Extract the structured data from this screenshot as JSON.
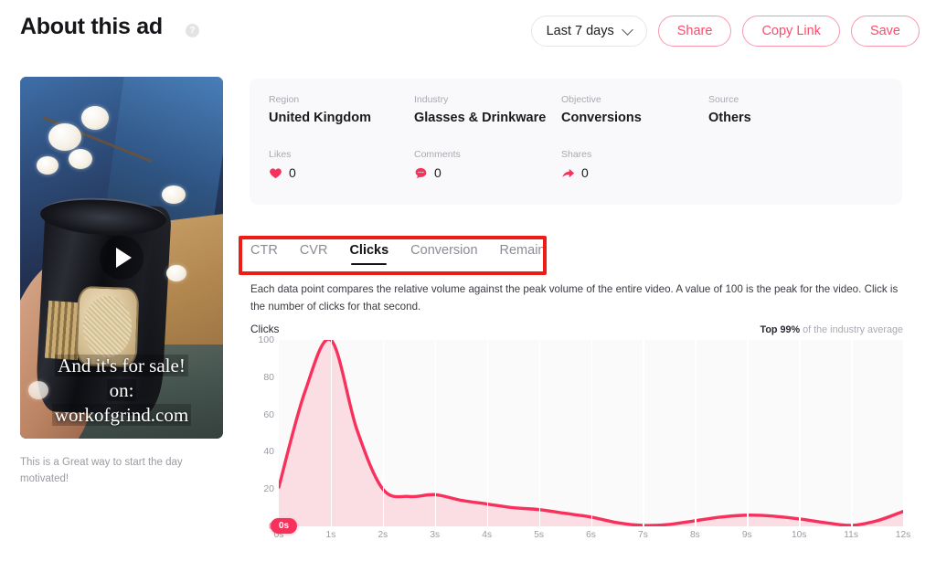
{
  "header": {
    "title": "About this ad",
    "help_icon": "question-mark-icon",
    "date_filter": "Last 7 days",
    "share_label": "Share",
    "copy_link_label": "Copy Link",
    "save_label": "Save"
  },
  "video": {
    "caption_line1": "And it's for sale!",
    "caption_line2": "on:",
    "caption_line3": "workofgrind.com",
    "description": "This is a Great way to start the day motivated!",
    "play_icon": "play-icon"
  },
  "info": {
    "region_label": "Region",
    "region_value": "United Kingdom",
    "industry_label": "Industry",
    "industry_value": "Glasses & Drinkware",
    "objective_label": "Objective",
    "objective_value": "Conversions",
    "source_label": "Source",
    "source_value": "Others",
    "likes_label": "Likes",
    "likes_value": "0",
    "comments_label": "Comments",
    "comments_value": "0",
    "shares_label": "Shares",
    "shares_value": "0"
  },
  "tabs": [
    {
      "label": "CTR",
      "active": false
    },
    {
      "label": "CVR",
      "active": false
    },
    {
      "label": "Clicks",
      "active": true
    },
    {
      "label": "Conversion",
      "active": false
    },
    {
      "label": "Remain",
      "active": false
    }
  ],
  "chart_description": "Each data point compares the relative volume against the peak volume of the entire video. A value of 100 is the peak for the video. Click is the number of clicks for that second.",
  "chart_header": {
    "title": "Clicks",
    "benchmark_prefix": "Top",
    "benchmark_value": "99%",
    "benchmark_suffix": "of the industry average"
  },
  "colors": {
    "accent_pink": "#f8305c",
    "accent_pink_light": "#fce0e7",
    "annotation_red": "#ee1c17",
    "panel_bg": "#f9f9fb",
    "plot_bg": "#fafafa"
  },
  "chart_data": {
    "type": "area",
    "title": "Clicks",
    "xlabel": "",
    "ylabel": "Clicks",
    "xlim": [
      0,
      12
    ],
    "ylim": [
      0,
      100
    ],
    "yticks": [
      0,
      20,
      40,
      60,
      80,
      100
    ],
    "xticks": [
      "0s",
      "1s",
      "2s",
      "3s",
      "4s",
      "5s",
      "6s",
      "7s",
      "8s",
      "9s",
      "10s",
      "11s",
      "12s"
    ],
    "grid": "vertical",
    "legend": "none",
    "marker_label": "0s",
    "series": [
      {
        "name": "Clicks",
        "x": [
          0,
          0.5,
          1,
          1.5,
          2,
          2.5,
          3,
          3.5,
          4,
          4.5,
          5,
          5.5,
          6,
          6.5,
          7,
          7.5,
          8,
          8.5,
          9,
          9.5,
          10,
          10.5,
          11,
          11.5,
          12
        ],
        "values": [
          21,
          72,
          100,
          52,
          20,
          16,
          17,
          14,
          12,
          10,
          9,
          7,
          5,
          2,
          0.5,
          1,
          3,
          5,
          6,
          5.5,
          4,
          2,
          0.5,
          3,
          8
        ]
      }
    ]
  }
}
